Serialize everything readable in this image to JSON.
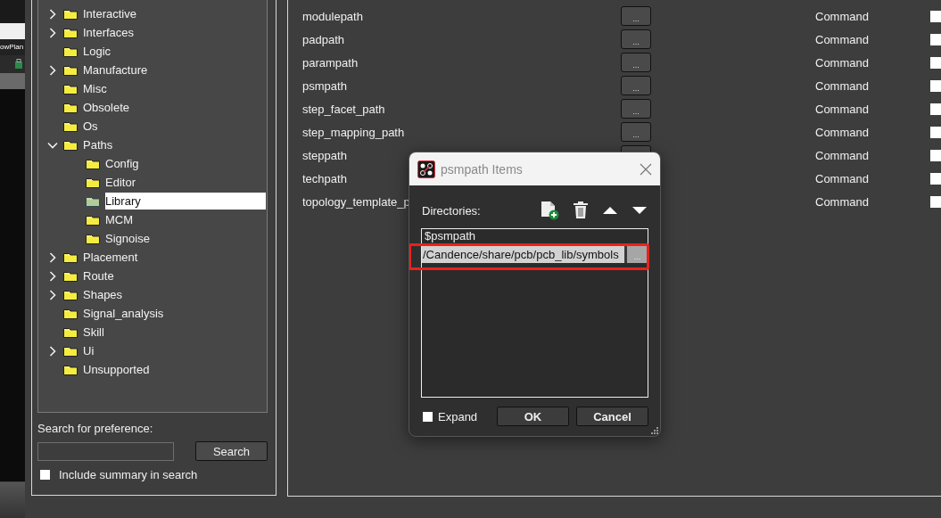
{
  "app_strip": {
    "tab_label": "owPlan"
  },
  "tree": {
    "items": [
      {
        "label": "Interactive",
        "kind": "branch",
        "expanded": false,
        "selected": false
      },
      {
        "label": "Interfaces",
        "kind": "branch",
        "expanded": false,
        "selected": false
      },
      {
        "label": "Logic",
        "kind": "leaf",
        "selected": false
      },
      {
        "label": "Manufacture",
        "kind": "branch",
        "expanded": false,
        "selected": false
      },
      {
        "label": "Misc",
        "kind": "leaf",
        "selected": false
      },
      {
        "label": "Obsolete",
        "kind": "leaf",
        "selected": false
      },
      {
        "label": "Os",
        "kind": "leaf",
        "selected": false
      },
      {
        "label": "Paths",
        "kind": "branch",
        "expanded": true,
        "selected": false,
        "children": [
          {
            "label": "Config",
            "selected": false
          },
          {
            "label": "Editor",
            "selected": false
          },
          {
            "label": "Library",
            "selected": true
          },
          {
            "label": "MCM",
            "selected": false
          },
          {
            "label": "Signoise",
            "selected": false
          }
        ]
      },
      {
        "label": "Placement",
        "kind": "branch",
        "expanded": false,
        "selected": false
      },
      {
        "label": "Route",
        "kind": "branch",
        "expanded": false,
        "selected": false
      },
      {
        "label": "Shapes",
        "kind": "branch",
        "expanded": false,
        "selected": false
      },
      {
        "label": "Signal_analysis",
        "kind": "leaf",
        "selected": false
      },
      {
        "label": "Skill",
        "kind": "leaf",
        "selected": false
      },
      {
        "label": "Ui",
        "kind": "branch",
        "expanded": false,
        "selected": false
      },
      {
        "label": "Unsupported",
        "kind": "leaf",
        "selected": false
      }
    ]
  },
  "search": {
    "label": "Search for preference:",
    "button": "Search",
    "include_summary": {
      "label": "Include summary in search",
      "checked": false
    }
  },
  "preferences": {
    "rows": [
      {
        "name": "modulepath",
        "button": "...",
        "type": "Command",
        "checked": false
      },
      {
        "name": "padpath",
        "button": "...",
        "type": "Command",
        "checked": false
      },
      {
        "name": "parampath",
        "button": "...",
        "type": "Command",
        "checked": false
      },
      {
        "name": "psmpath",
        "button": "...",
        "type": "Command",
        "checked": false
      },
      {
        "name": "step_facet_path",
        "button": "...",
        "type": "Command",
        "checked": false
      },
      {
        "name": "step_mapping_path",
        "button": "...",
        "type": "Command",
        "checked": false
      },
      {
        "name": "steppath",
        "has_button": true,
        "type": "Command",
        "checked": false
      },
      {
        "name": "techpath",
        "type": "Command",
        "checked": false
      },
      {
        "name": "topology_template_p",
        "type": "Command",
        "checked": false
      }
    ]
  },
  "dialog": {
    "title": "psmpath Items",
    "directories_label": "Directories:",
    "items": [
      {
        "value": "$psmpath",
        "editing": false,
        "highlighted": false
      },
      {
        "value": "/Candence/share/pcb/pcb_lib/symbols",
        "editing": true,
        "highlighted": true,
        "button": "..."
      }
    ],
    "expand": {
      "label": "Expand",
      "checked": false
    },
    "buttons": [
      "OK",
      "Cancel"
    ]
  }
}
